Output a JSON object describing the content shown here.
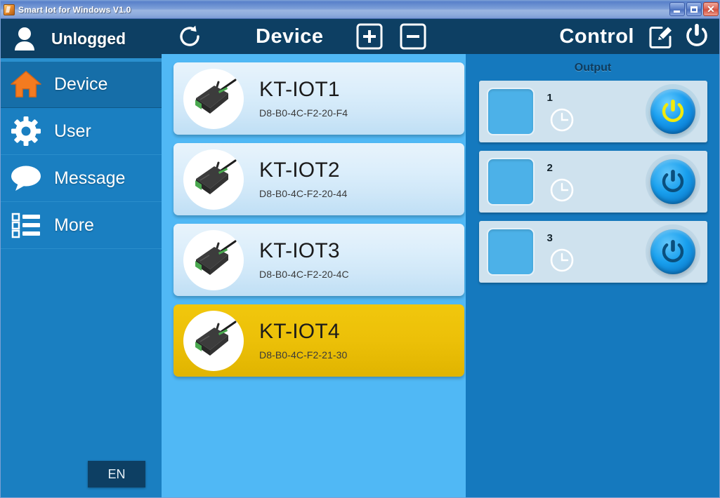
{
  "window": {
    "title": "Smart Iot for Windows V1.0",
    "icon": "app-icon",
    "controls": {
      "minimize": "minimize-button",
      "maximize": "maximize-button",
      "close": "close-button"
    }
  },
  "sidebar": {
    "user": {
      "label": "Unlogged",
      "icon": "person-icon"
    },
    "items": [
      {
        "label": "Device",
        "icon": "home-icon",
        "active": true,
        "icon_color": "#f47b20"
      },
      {
        "label": "User",
        "icon": "gear-icon",
        "active": false,
        "icon_color": "#ffffff"
      },
      {
        "label": "Message",
        "icon": "chat-bubble-icon",
        "active": false,
        "icon_color": "#ffffff"
      },
      {
        "label": "More",
        "icon": "list-icon",
        "active": false,
        "icon_color": "#ffffff"
      }
    ],
    "language_button": "EN"
  },
  "device_header": {
    "refresh_icon": "refresh-icon",
    "title": "Device",
    "add_icon": "plus-square-icon",
    "remove_icon": "minus-square-icon"
  },
  "control_header": {
    "title": "Control",
    "edit_icon": "edit-square-icon",
    "power_icon": "power-icon"
  },
  "devices": [
    {
      "name": "KT-IOT1",
      "mac": "D8-B0-4C-F2-20-F4",
      "selected": false
    },
    {
      "name": "KT-IOT2",
      "mac": "D8-B0-4C-F2-20-44",
      "selected": false
    },
    {
      "name": "KT-IOT3",
      "mac": "D8-B0-4C-F2-20-4C",
      "selected": false
    },
    {
      "name": "KT-IOT4",
      "mac": "D8-B0-4C-F2-21-30",
      "selected": true
    }
  ],
  "output": {
    "title": "Output",
    "rows": [
      {
        "number": "1",
        "state": "on",
        "clock_icon": "clock-icon",
        "thumb": "channel-thumbnail"
      },
      {
        "number": "2",
        "state": "off",
        "clock_icon": "clock-icon",
        "thumb": "channel-thumbnail"
      },
      {
        "number": "3",
        "state": "off",
        "clock_icon": "clock-icon",
        "thumb": "channel-thumbnail"
      }
    ]
  },
  "colors": {
    "titlebar": "#7c9ed8",
    "sidebar": "#1a7fc1",
    "sidebar_dark": "#0d3f63",
    "sidebar_active": "#166ea8",
    "list_panel": "#50b8f5",
    "control_panel": "#1579be",
    "selected_card": "#ecc008",
    "accent_orange": "#f47b20",
    "power_on_glyph": "#f2ea0a",
    "power_off_glyph": "#0a4f7d"
  }
}
